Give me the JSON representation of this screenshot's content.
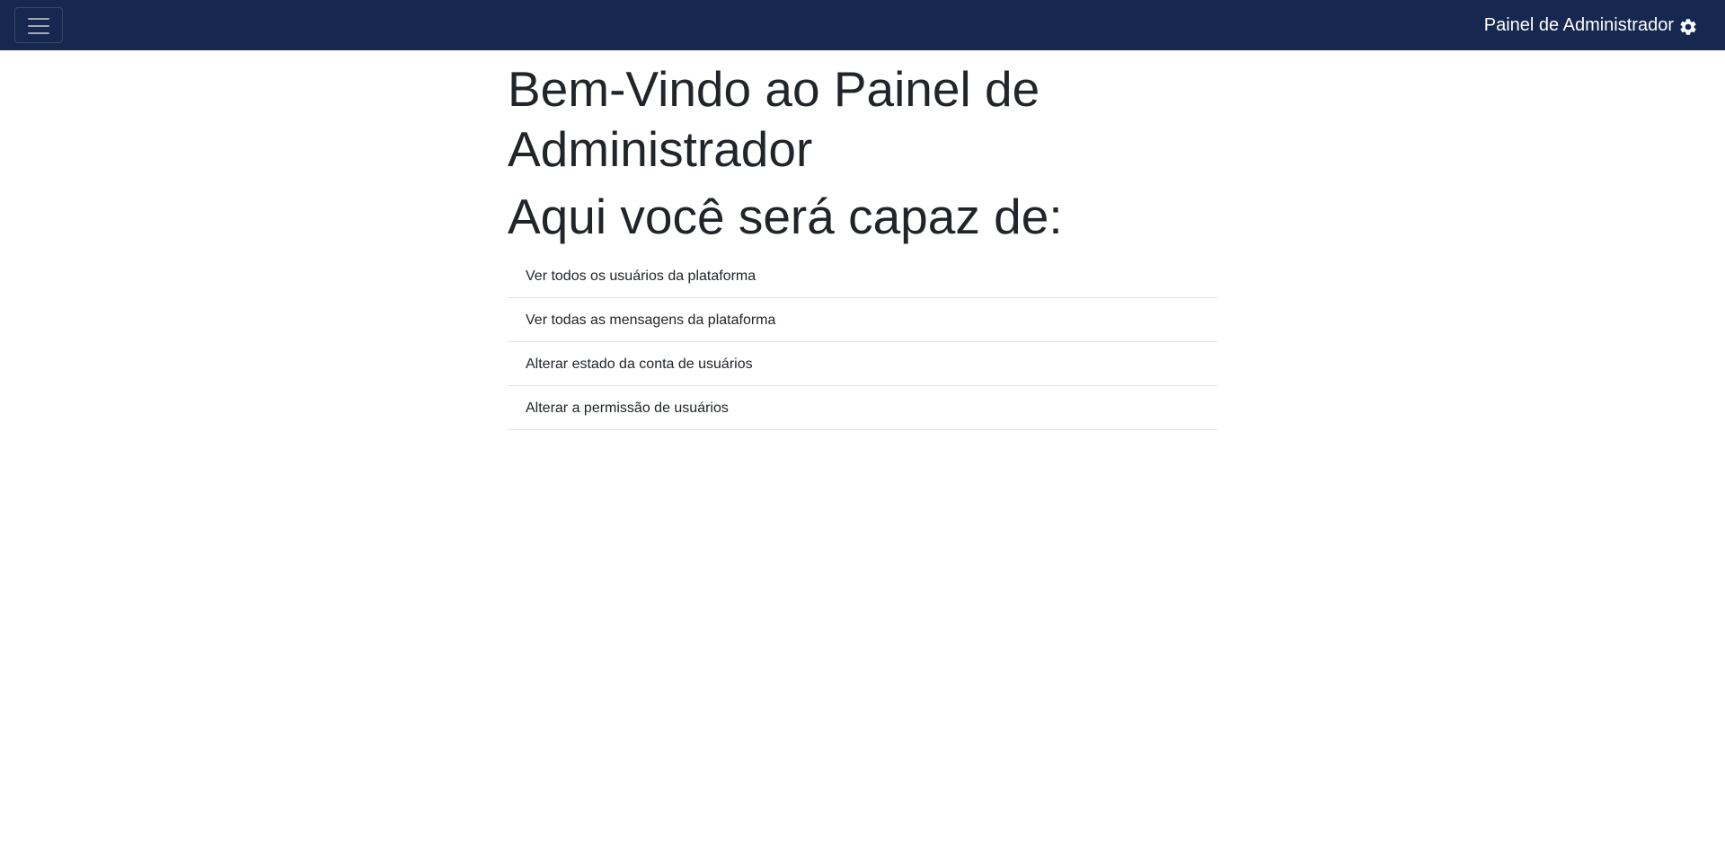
{
  "navbar": {
    "toggle_icon": "hamburger-menu-icon",
    "brand_label": "Painel de Administrador",
    "brand_icon": "gear-icon",
    "background": "#16284f"
  },
  "main": {
    "title": "Bem-Vindo ao Painel de Administrador",
    "subtitle": "Aqui você será capaz de:",
    "items": [
      {
        "label": "Ver todos os usuários da plataforma"
      },
      {
        "label": "Ver todas as mensagens da plataforma"
      },
      {
        "label": "Alterar estado da conta de usuários"
      },
      {
        "label": "Alterar a permissão de usuários"
      }
    ]
  }
}
